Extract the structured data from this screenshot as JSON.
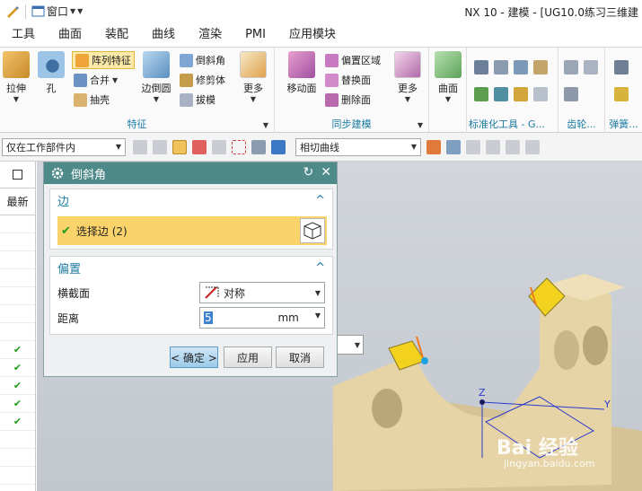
{
  "titlebar": {
    "window_menu": "窗口",
    "title": "NX 10 - 建模 - [UG10.0练习三维建"
  },
  "tabs": [
    "工具",
    "曲面",
    "装配",
    "曲线",
    "渲染",
    "PMI",
    "应用模块"
  ],
  "ribbon": {
    "big": {
      "pull": "拉伸",
      "hole": "孔",
      "edge_blend": "边倒圆",
      "more1": "更多",
      "move_face": "移动面",
      "more2": "更多",
      "surface": "曲面"
    },
    "small": {
      "pattern": "阵列特征",
      "unite": "合并",
      "shell": "抽壳",
      "chamfer": "倒斜角",
      "trim_body": "修剪体",
      "draft": "拔模",
      "offset_region": "偏置区域",
      "replace_face": "替换面",
      "delete_face": "删除面"
    },
    "groups": {
      "feature": "特征",
      "sync": "同步建模",
      "std_tools": "标准化工具 - G...",
      "gear": "齿轮...",
      "spring": "弹簧..."
    }
  },
  "selbar": {
    "filter": "仅在工作部件内",
    "curve_rule": "相切曲线"
  },
  "navigator": {
    "header": "最新",
    "rows": [
      "",
      "",
      "",
      "",
      "",
      "",
      "",
      "",
      "",
      "",
      "",
      "",
      "",
      "",
      "",
      ""
    ],
    "checks": [
      false,
      false,
      false,
      false,
      false,
      false,
      false,
      true,
      true,
      true,
      true,
      true,
      false,
      false,
      false,
      false
    ]
  },
  "dialog": {
    "title": "倒斜角",
    "edge_section": "边",
    "select_edge": "选择边 (2)",
    "offset_section": "偏置",
    "cross_section_label": "横截面",
    "cross_section_value": "对称",
    "distance_label": "距离",
    "distance_value": "5",
    "distance_unit": "mm",
    "ok": "< 确定 >",
    "apply": "应用",
    "cancel": "取消"
  },
  "viewport": {
    "axis_z": "Z",
    "axis_y": "Y",
    "watermark_brand": "Bai 经验",
    "watermark_url": "jingyan.baidu.com"
  },
  "colors": {
    "dialog_title": "#4f8a8a",
    "select_row": "#fbd36b",
    "part": "#e6d3a6",
    "accent": "#1a7aa0",
    "check": "#1e9c1e"
  }
}
